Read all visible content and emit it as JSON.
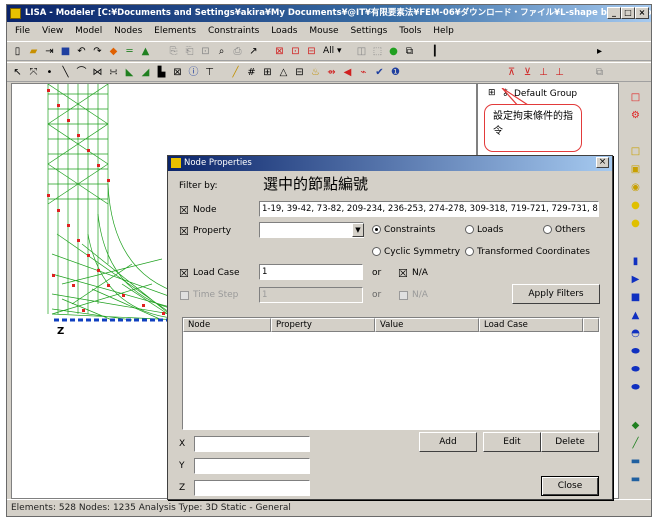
{
  "window": {
    "title": "LISA - Modeler [C:¥Documents and Settings¥akira¥My Documents¥@IT¥有限要素法¥FEM-06¥ダウンロード・ファイル¥L-shape bracket.vol]",
    "min_label": "_",
    "max_label": "□",
    "close_label": "×"
  },
  "menu": [
    "File",
    "View",
    "Model",
    "Nodes",
    "Elements",
    "Constraints",
    "Loads",
    "Mouse",
    "Settings",
    "Tools",
    "Help"
  ],
  "toolbar": {
    "all_label": "All"
  },
  "tree": {
    "group_label": "Default Group",
    "expander": "⊞"
  },
  "canvas": {
    "axis_label": "Z"
  },
  "callout": {
    "text": "設定拘束條件的指令"
  },
  "caption": {
    "text": "選中的節點編號"
  },
  "status": {
    "text": "Elements: 528   Nodes: 1235   Analysis Type: 3D Static - General"
  },
  "dialog": {
    "title": "Node Properties",
    "close_label": "×",
    "filter_by": "Filter by:",
    "node_check": "☒",
    "node_label": "Node",
    "node_value": "1-19, 39-42, 73-82, 209-234, 236-253, 274-278, 309-318, 719-721, 729-731, 83",
    "property_check": "☒",
    "property_label": "Property",
    "radio_constraints": "Constraints",
    "radio_loads": "Loads",
    "radio_others": "Others",
    "radio_cyclic": "Cyclic Symmetry",
    "radio_transformed": "Transformed Coordinates",
    "loadcase_check": "☒",
    "loadcase_label": "Load Case",
    "loadcase_value": "1",
    "or1": "or",
    "na1_check": "☒",
    "na1_label": "N/A",
    "timestep_label": "Time Step",
    "timestep_value": "1",
    "or2": "or",
    "na2_label": "N/A",
    "apply_filters": "Apply Filters",
    "columns": [
      "Node",
      "Property",
      "Value",
      "Load Case"
    ],
    "x_label": "X",
    "y_label": "Y",
    "z_label": "Z",
    "add": "Add",
    "edit": "Edit",
    "delete": "Delete",
    "close": "Close"
  }
}
